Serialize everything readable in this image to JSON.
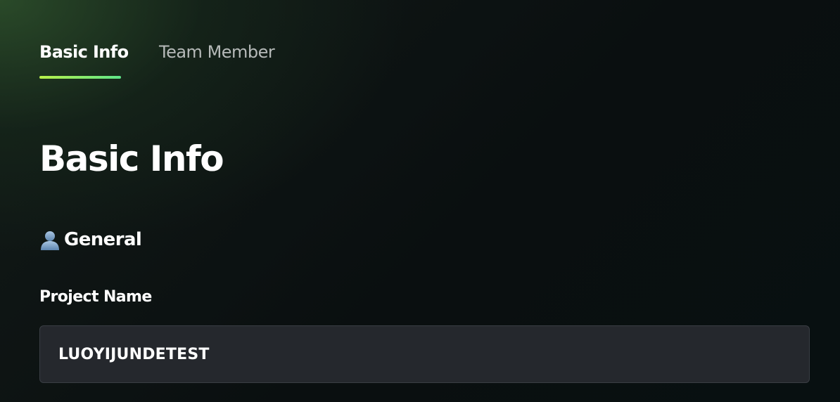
{
  "tabs": [
    {
      "label": "Basic Info",
      "active": true
    },
    {
      "label": "Team Member",
      "active": false
    }
  ],
  "page": {
    "title": "Basic Info"
  },
  "section": {
    "icon": "person-icon",
    "label": "General"
  },
  "project_name": {
    "label": "Project Name",
    "value": "LUOYIJUNDETEST"
  },
  "colors": {
    "accent_gradient_start": "#b8f04a",
    "accent_gradient_end": "#5fe68a",
    "input_background": "#25282d",
    "inactive_tab_text": "#b6bab9"
  }
}
